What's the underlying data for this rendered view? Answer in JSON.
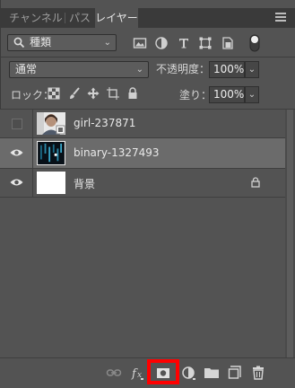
{
  "tabs": [
    {
      "label": "チャンネル",
      "active": false
    },
    {
      "label": "パス",
      "active": false
    },
    {
      "label": "レイヤー",
      "active": true
    }
  ],
  "filter": {
    "kind_label": "種類",
    "icons": [
      "pixel-filter-icon",
      "adjustment-filter-icon",
      "type-filter-icon",
      "shape-filter-icon",
      "smart-object-filter-icon",
      "filter-toggle-icon"
    ]
  },
  "blend": {
    "mode": "通常",
    "opacity_label": "不透明度：",
    "opacity_value": "100%"
  },
  "lock": {
    "label": "ロック：",
    "fill_label": "塗り：",
    "fill_value": "100%"
  },
  "layers": [
    {
      "name": "girl-237871",
      "visible": false,
      "selected": false,
      "locked": false
    },
    {
      "name": "binary-1327493",
      "visible": true,
      "selected": true,
      "locked": false
    },
    {
      "name": "背景",
      "visible": true,
      "selected": false,
      "locked": true
    }
  ],
  "bottom_icons": [
    "link-layers-icon",
    "fx-icon",
    "add-mask-icon",
    "adjustment-layer-icon",
    "new-group-icon",
    "new-layer-icon",
    "delete-icon"
  ],
  "colors": {
    "highlight": "#ff0000",
    "panel": "#535353",
    "selected_row": "#6b6b6b"
  }
}
